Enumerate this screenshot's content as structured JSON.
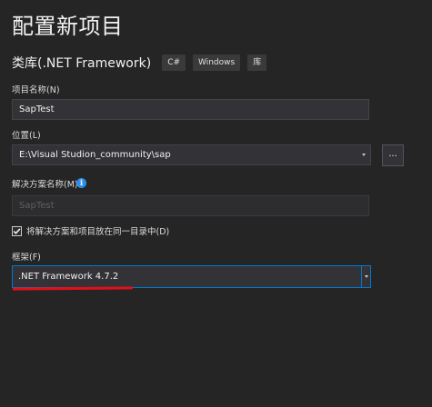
{
  "page": {
    "title": "配置新项目"
  },
  "template": {
    "name": "类库(.NET Framework)",
    "tags": [
      "C#",
      "Windows",
      "库"
    ]
  },
  "fields": {
    "project_name": {
      "label": "项目名称(N)",
      "value": "SapTest"
    },
    "location": {
      "label": "位置(L)",
      "value": "E:\\Visual Studion_community\\sap",
      "browse_label": "..."
    },
    "solution_name": {
      "label": "解决方案名称(M)",
      "value": "SapTest",
      "info_icon": "i"
    },
    "same_directory": {
      "label": "将解决方案和项目放在同一目录中(D)",
      "checked": true
    },
    "framework": {
      "label": "框架(F)",
      "value": ".NET Framework 4.7.2"
    }
  },
  "colors": {
    "background": "#252526",
    "input_background": "#333337",
    "focus_border": "#007acc",
    "annotation_underline": "#e2101a",
    "info_icon": "#2f8ee5"
  },
  "icons": {
    "info": "info-icon",
    "checkmark": "checkmark-icon",
    "dropdown": "chevron-down-icon"
  }
}
